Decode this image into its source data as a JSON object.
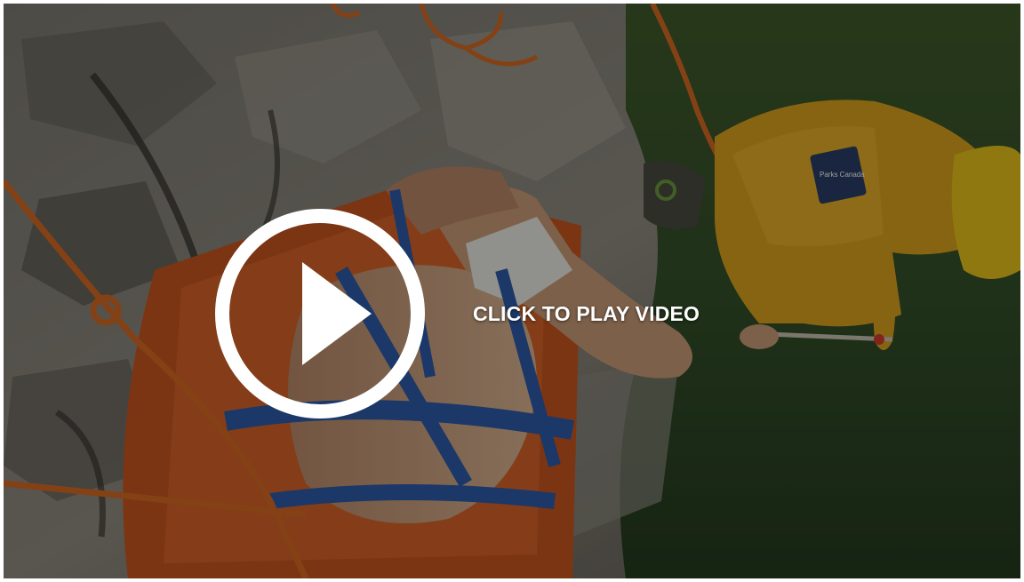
{
  "video": {
    "play_label": "CLICK TO PLAY VIDEO",
    "patch_text": "Parks Canada"
  },
  "icons": {
    "play": "play-circle-icon"
  },
  "colors": {
    "overlay": "#000000",
    "play_icon": "#ffffff",
    "label": "#ffffff"
  }
}
